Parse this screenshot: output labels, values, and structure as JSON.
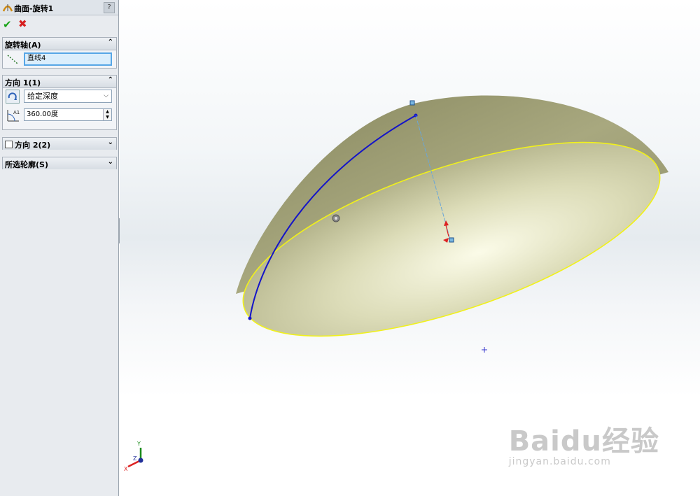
{
  "panel": {
    "title": "曲面-旋转1",
    "help": "?",
    "axis_group": {
      "title": "旋转轴(A)",
      "axis_value": "直线4"
    },
    "direction1_group": {
      "title": "方向 1(1)",
      "end_condition": "给定深度",
      "angle": "360.00度"
    },
    "direction2_group": {
      "title": "方向 2(2)"
    },
    "contours_group": {
      "title": "所选轮廓(S)"
    }
  },
  "triad": {
    "x": "X",
    "y": "Y",
    "z": "Z"
  },
  "watermark": {
    "logo": "Baidu经验",
    "url": "jingyan.baidu.com"
  },
  "colors": {
    "surface": "#a3a377",
    "edge": "#f1f11a",
    "profile": "#1414c8",
    "axis": "#6aa6d8"
  }
}
